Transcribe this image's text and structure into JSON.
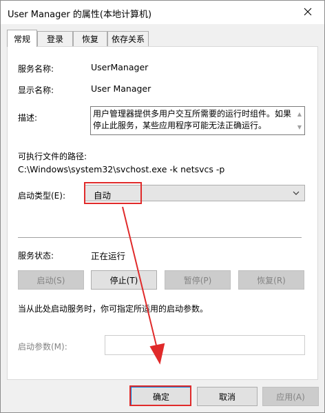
{
  "window": {
    "title": "User Manager 的属性(本地计算机)"
  },
  "tabs": [
    {
      "label": "常规",
      "active": true
    },
    {
      "label": "登录",
      "active": false
    },
    {
      "label": "恢复",
      "active": false
    },
    {
      "label": "依存关系",
      "active": false
    }
  ],
  "general": {
    "service_name_label": "服务名称:",
    "service_name_value": "UserManager",
    "display_name_label": "显示名称:",
    "display_name_value": "User Manager",
    "description_label": "描述:",
    "description_value": "用户管理器提供多用户交互所需要的运行时组件。如果停止此服务，某些应用程序可能无法正确运行。",
    "path_label": "可执行文件的路径:",
    "path_value": "C:\\Windows\\system32\\svchost.exe -k netsvcs -p",
    "startup_type_label": "启动类型(E):",
    "startup_type_value": "自动",
    "status_label": "服务状态:",
    "status_value": "正在运行",
    "start_button": "启动(S)",
    "stop_button": "停止(T)",
    "pause_button": "暂停(P)",
    "resume_button": "恢复(R)",
    "hint_text": "当从此处启动服务时，你可指定所适用的启动参数。",
    "start_params_label": "启动参数(M):",
    "start_params_value": ""
  },
  "footer": {
    "ok_button": "确定",
    "cancel_button": "取消",
    "apply_button": "应用(A)"
  },
  "colors": {
    "annotation_red": "#e02a2a"
  }
}
